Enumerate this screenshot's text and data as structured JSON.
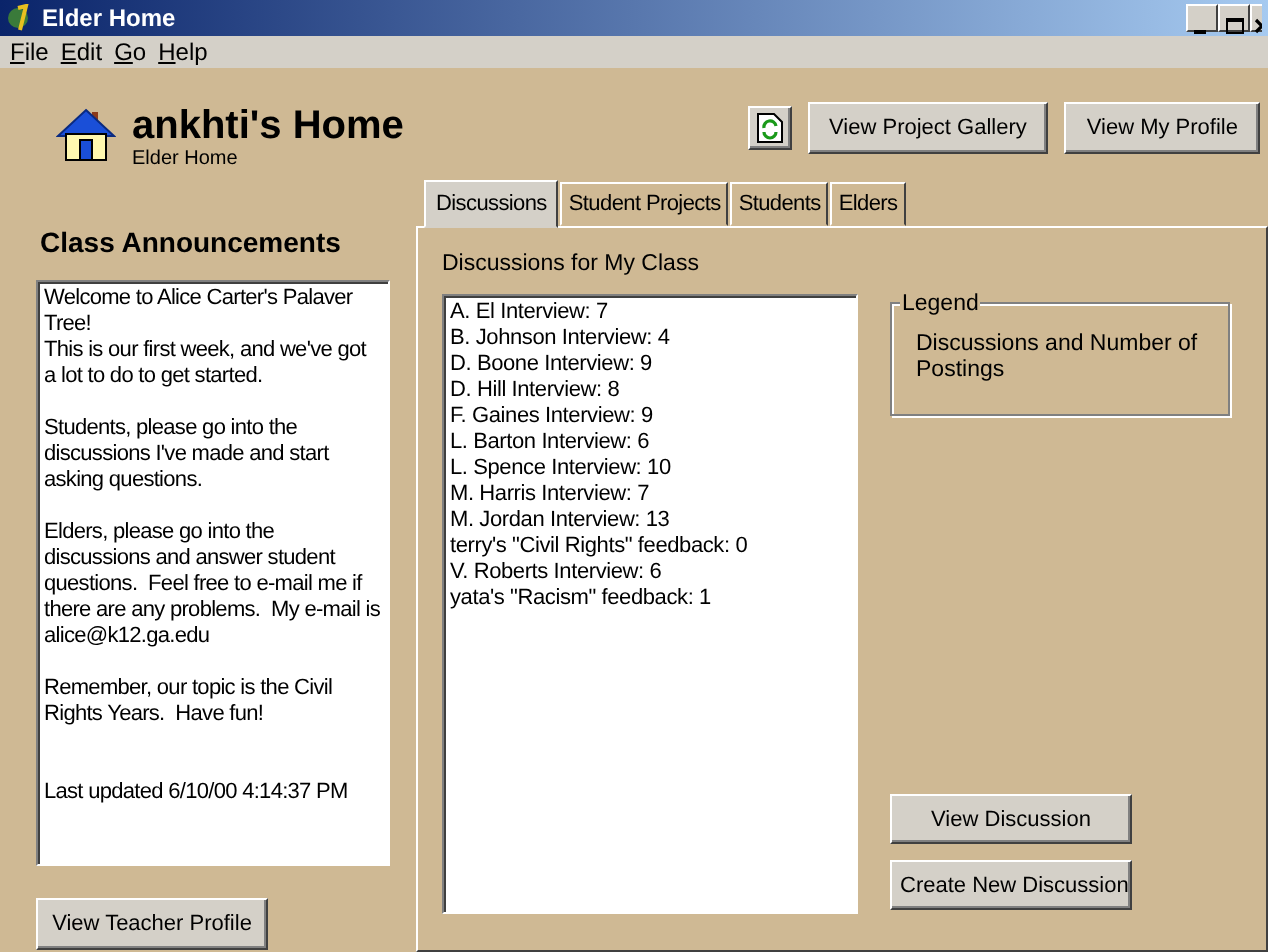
{
  "window": {
    "title": "Elder Home"
  },
  "menu": [
    "File",
    "Edit",
    "Go",
    "Help"
  ],
  "header": {
    "title": "ankhti's Home",
    "subtitle": "Elder Home"
  },
  "toolbar_buttons": [
    {
      "kind": "icon"
    },
    {
      "kind": "text",
      "label": "View Project Gallery"
    },
    {
      "kind": "text",
      "label": "View My Profile"
    }
  ],
  "announcements": {
    "heading": "Class Announcements",
    "paragraphs": [
      "Welcome to Alice Carter's Palaver Tree!\nThis is our first week, and we've got a lot to do to get started.",
      "Students, please go into the discussions I've made and start asking questions.",
      "Elders, please go into the discussions and answer student questions.  Feel free to e-mail me if there are any problems.  My e-mail is alice@k12.ga.edu",
      "Remember, our topic is the Civil Rights Years.  Have fun!",
      "Last updated 6/10/00 4:14:37 PM"
    ],
    "button": "View Teacher Profile"
  },
  "tabs": [
    {
      "label": "Discussions",
      "selected": true
    },
    {
      "label": "Student Projects",
      "selected": false
    },
    {
      "label": "Students",
      "selected": false
    },
    {
      "label": "Elders",
      "selected": false
    }
  ],
  "discussions": {
    "label": "Discussions for My Class",
    "items": [
      "A. El Interview: 7",
      "B. Johnson Interview: 4",
      "D. Boone Interview: 9",
      "D. Hill Interview: 8",
      "F. Gaines Interview: 9",
      "L. Barton Interview: 6",
      "L. Spence Interview: 10",
      "M. Harris Interview: 7",
      "M. Jordan Interview: 13",
      "terry's \"Civil Rights\" feedback: 0",
      "V. Roberts Interview: 6",
      "yata's \"Racism\" feedback: 1"
    ]
  },
  "legend": {
    "title": "Legend",
    "text": "Discussions and Number of Postings"
  },
  "action_buttons": [
    "View Discussion",
    "Create New Discussion"
  ]
}
